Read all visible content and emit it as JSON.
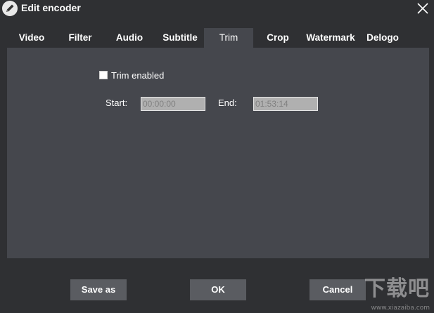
{
  "window": {
    "title": "Edit encoder"
  },
  "tabs": [
    {
      "label": "Video",
      "active": false
    },
    {
      "label": "Filter",
      "active": false
    },
    {
      "label": "Audio",
      "active": false
    },
    {
      "label": "Subtitle",
      "active": false
    },
    {
      "label": "Trim",
      "active": true
    },
    {
      "label": "Crop",
      "active": false
    },
    {
      "label": "Watermark",
      "active": false
    },
    {
      "label": "Delogo",
      "active": false
    }
  ],
  "trim": {
    "enabled_label": "Trim enabled",
    "enabled": false,
    "start_label": "Start:",
    "start_value": "00:00:00",
    "end_label": "End:",
    "end_value": "01:53:14"
  },
  "buttons": {
    "save_as": "Save as",
    "ok": "OK",
    "cancel": "Cancel"
  },
  "watermark": {
    "text": "下载吧",
    "url": "www.xiazaiba.com"
  },
  "colors": {
    "background": "#2f3033",
    "panel": "#45474d",
    "button": "#5a5c61",
    "input_bg": "#b0b0b0"
  }
}
